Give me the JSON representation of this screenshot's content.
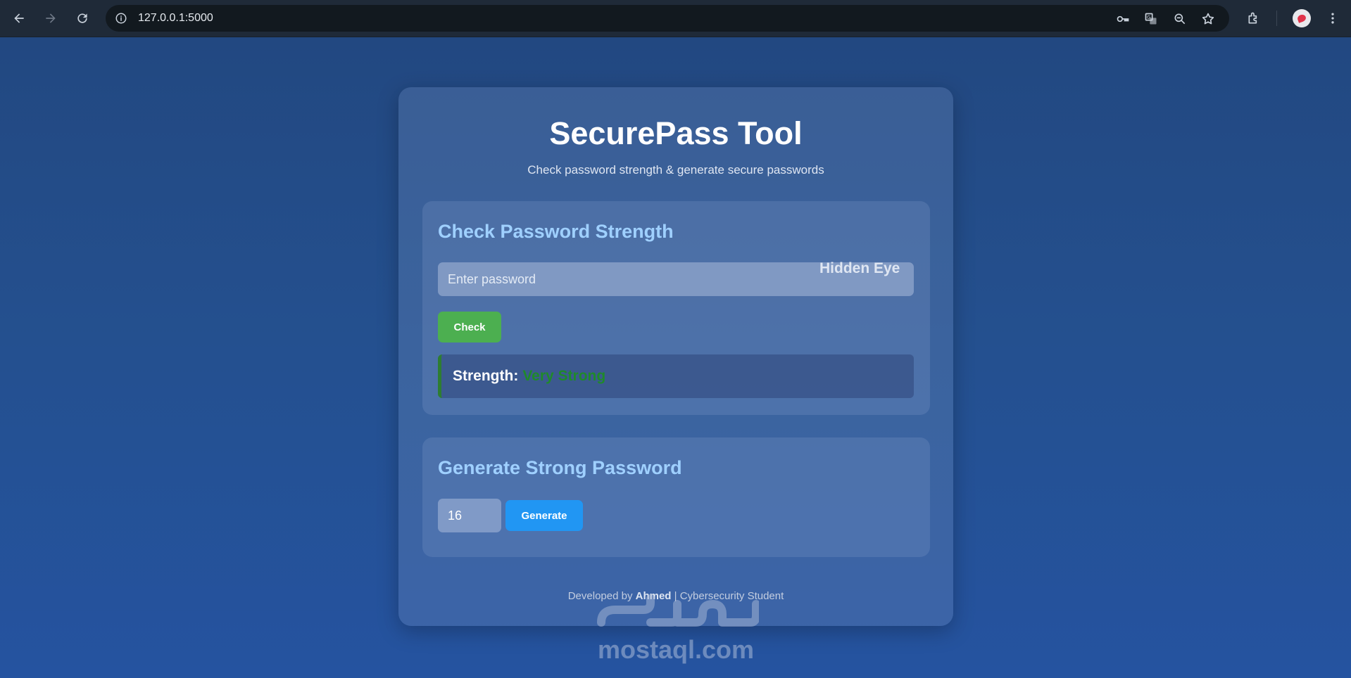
{
  "browser": {
    "url": "127.0.0.1:5000"
  },
  "page": {
    "title": "SecurePass Tool",
    "subtitle": "Check password strength & generate secure passwords"
  },
  "check_section": {
    "title": "Check Password Strength",
    "password_placeholder": "Enter password",
    "eye_label": "Hidden Eye",
    "check_button": "Check",
    "result_label": "Strength:",
    "result_value": "Very Strong"
  },
  "generate_section": {
    "title": "Generate Strong Password",
    "length_value": "16",
    "generate_button": "Generate"
  },
  "footer": {
    "prefix": "Developed by",
    "author": "Ahmed",
    "suffix": "| Cybersecurity Student"
  },
  "watermark": {
    "text": "mostaql.com",
    "arabic": "مستقل"
  },
  "colors": {
    "check_button": "#4caf50",
    "generate_button": "#2196f3",
    "strength_value": "#1f8a2a",
    "section_title": "#9fd0ff"
  }
}
